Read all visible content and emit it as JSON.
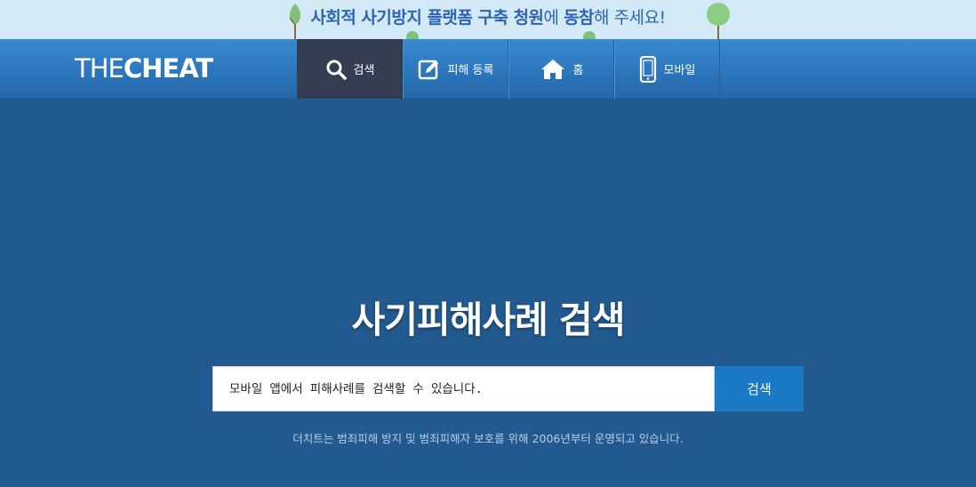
{
  "banner": {
    "part1": "사회적 사기방지 플랫폼 구축 청원",
    "part2": "에 ",
    "part3": "동참",
    "part4": "해 주세요!"
  },
  "logo": {
    "thin": "THE",
    "bold": "CHEAT"
  },
  "nav": {
    "search": "검색",
    "report": "피해 등록",
    "home": "홈",
    "mobile": "모바일"
  },
  "main": {
    "title": "사기피해사례 검색",
    "search_placeholder": "모바일 앱에서 피해사례를 검색할 수 있습니다.",
    "search_button": "검색",
    "footnote": "더치트는 범죄피해 방지 및 범죄피해자 보호를 위해 2006년부터 운영되고 있습니다."
  },
  "colors": {
    "background": "#225a90",
    "banner_bg": "#d3eaf6",
    "banner_text": "#2c65b3",
    "navbar": "#2c76bc",
    "nav_active": "#353d52",
    "search_button": "#1a79c4"
  }
}
